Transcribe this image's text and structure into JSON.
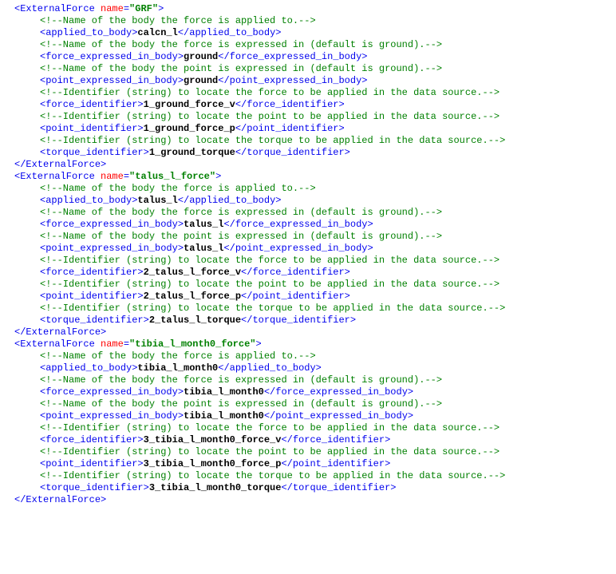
{
  "forces": [
    {
      "name": "GRF",
      "applied_to_body": "calcn_l",
      "force_expressed_in_body": "ground",
      "point_expressed_in_body": "ground",
      "force_identifier": "1_ground_force_v",
      "point_identifier": "1_ground_force_p",
      "torque_identifier": "1_ground_torque"
    },
    {
      "name": "talus_l_force",
      "applied_to_body": "talus_l",
      "force_expressed_in_body": "talus_l",
      "point_expressed_in_body": "talus_l",
      "force_identifier": "2_talus_l_force_v",
      "point_identifier": "2_talus_l_force_p",
      "torque_identifier": "2_talus_l_torque"
    },
    {
      "name": "tibia_l_month0_force",
      "applied_to_body": "tibia_l_month0",
      "force_expressed_in_body": "tibia_l_month0",
      "point_expressed_in_body": "tibia_l_month0",
      "force_identifier": "3_tibia_l_month0_force_v",
      "point_identifier": "3_tibia_l_month0_force_p",
      "torque_identifier": "3_tibia_l_month0_torque"
    }
  ],
  "comments": {
    "applied_to_body": "Name of the body the force is applied to.",
    "force_expressed_in_body": "Name of the body the force is expressed in (default is ground).",
    "point_expressed_in_body": "Name of the body the point is expressed in (default is ground).",
    "force_identifier": "Identifier (string) to locate the force to be applied in the data source.",
    "point_identifier": "Identifier (string) to locate the point to be applied in the data source.",
    "torque_identifier": "Identifier (string) to locate the torque to be applied in the data source."
  },
  "tagname": "ExternalForce",
  "name_attr": "name"
}
